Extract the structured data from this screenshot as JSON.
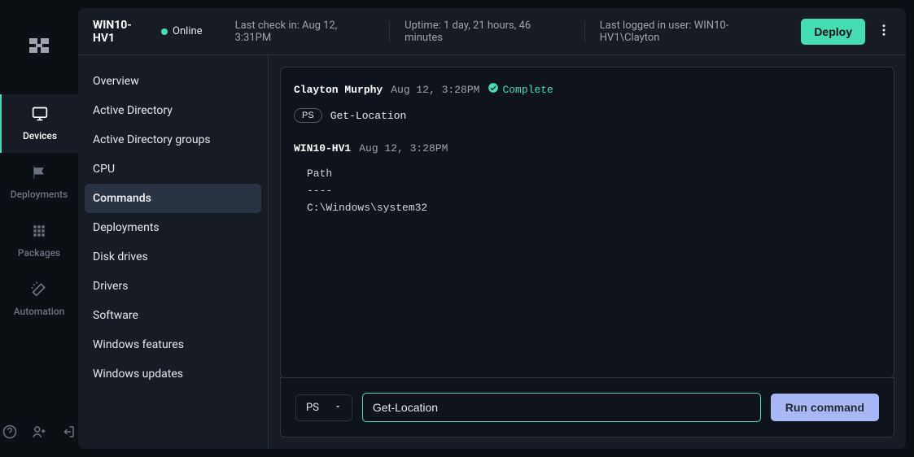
{
  "nav": {
    "items": [
      {
        "label": "Devices"
      },
      {
        "label": "Deployments"
      },
      {
        "label": "Packages"
      },
      {
        "label": "Automation"
      }
    ]
  },
  "header": {
    "host": "WIN10-HV1",
    "status": "Online",
    "last_checkin": "Last check in: Aug 12, 3:31PM",
    "uptime": "Uptime: 1 day, 21 hours, 46 minutes",
    "last_user": "Last logged in user: WIN10-HV1\\Clayton",
    "deploy_label": "Deploy"
  },
  "sidebar": {
    "items": [
      {
        "label": "Overview"
      },
      {
        "label": "Active Directory"
      },
      {
        "label": "Active Directory groups"
      },
      {
        "label": "CPU"
      },
      {
        "label": "Commands"
      },
      {
        "label": "Deployments"
      },
      {
        "label": "Disk drives"
      },
      {
        "label": "Drivers"
      },
      {
        "label": "Software"
      },
      {
        "label": "Windows features"
      },
      {
        "label": "Windows updates"
      }
    ]
  },
  "command": {
    "user": "Clayton Murphy",
    "sent_time": "Aug 12, 3:28PM",
    "status_label": "Complete",
    "shell_badge": "PS",
    "command_text": "Get-Location",
    "response_host": "WIN10-HV1",
    "response_time": "Aug 12, 3:28PM",
    "response_body": "Path\n----\nC:\\Windows\\system32"
  },
  "input": {
    "shell": "PS",
    "value": "Get-Location",
    "run_label": "Run command"
  }
}
